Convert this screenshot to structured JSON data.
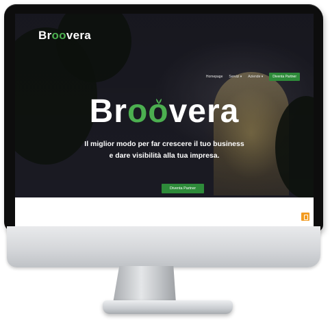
{
  "brand": {
    "logo_prefix": "Br",
    "logo_oo": "oo",
    "logo_suffix": "vera",
    "accent_color": "#4caf50"
  },
  "nav": {
    "items": [
      "Homepage",
      "Servizi ▾",
      "Aziende ▾"
    ],
    "cta_label": "Diventa Partner"
  },
  "hero": {
    "title_prefix": "Br",
    "title_oo": "oo",
    "title_suffix": "vera",
    "subtitle_line1": "Il miglior modo per far crescere il tuo business",
    "subtitle_line2": "e dare visibilità alla tua impresa.",
    "cta_label": "Diventa Partner"
  },
  "floating_button": {
    "icon": "chat-icon",
    "color": "#f29b21"
  }
}
